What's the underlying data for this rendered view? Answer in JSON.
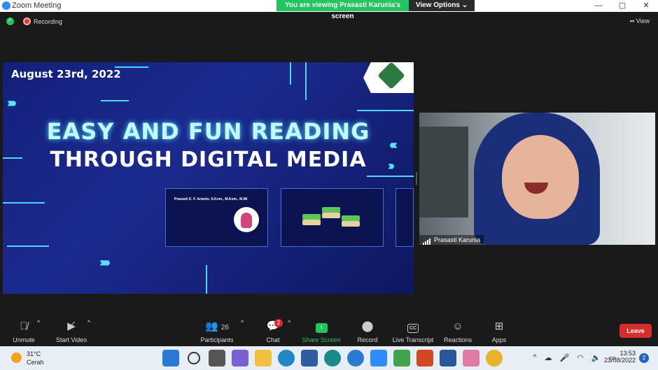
{
  "window": {
    "title": "Zoom Meeting",
    "controls": [
      "—",
      "▢",
      "✕"
    ]
  },
  "banner": {
    "viewing_text": "You are viewing Prasasti Karunia's screen",
    "view_options_label": "View Options ⌄"
  },
  "status": {
    "recording_label": "Recording",
    "view_label": "View"
  },
  "slide": {
    "date": "August 23rd, 2022",
    "title_line1": "EASY AND FUN READING",
    "title_line2": "THROUGH DIGITAL MEDIA",
    "thumb_name": "Prasasti K. F. Ananto, S.Kom., M.Kom., M.IM"
  },
  "video": {
    "participant_name": "Prasasti Karunia"
  },
  "toolbar": {
    "unmute_label": "Unmute",
    "start_video_label": "Start Video",
    "participants_label": "Participants",
    "participants_count": "26",
    "chat_label": "Chat",
    "chat_badge": "2",
    "share_screen_label": "Share Screen",
    "record_label": "Record",
    "live_transcript_label": "Live Transcript",
    "cc_icon_text": "CC",
    "reactions_label": "Reactions",
    "apps_label": "Apps",
    "leave_label": "Leave"
  },
  "taskbar": {
    "temperature": "31°C",
    "condition": "Cerah",
    "time": "13:53",
    "date": "23/08/2022",
    "notification_count": "2"
  },
  "colors": {
    "share_green": "#23c55e",
    "leave_red": "#d92d2d",
    "slide_blue": "#1b2a8e"
  }
}
